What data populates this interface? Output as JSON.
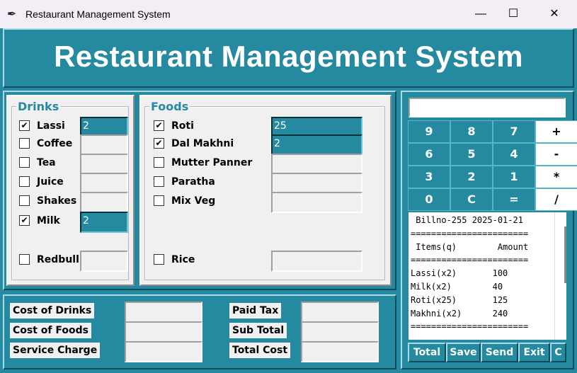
{
  "window": {
    "title": "Restaurant Management System",
    "minimize_glyph": "—",
    "maximize_glyph": "☐",
    "close_glyph": "✕"
  },
  "header": {
    "title": "Restaurant Management System"
  },
  "drinks": {
    "legend": "Drinks",
    "items": [
      {
        "label": "Lassi",
        "checked": true,
        "value": "2"
      },
      {
        "label": "Coffee",
        "checked": false,
        "value": ""
      },
      {
        "label": "Tea",
        "checked": false,
        "value": ""
      },
      {
        "label": "Juice",
        "checked": false,
        "value": ""
      },
      {
        "label": "Shakes",
        "checked": false,
        "value": ""
      },
      {
        "label": "Milk",
        "checked": true,
        "value": "2"
      },
      {
        "label": "Redbull",
        "checked": false,
        "value": ""
      }
    ]
  },
  "foods": {
    "legend": "Foods",
    "items": [
      {
        "label": "Roti",
        "checked": true,
        "value": "25"
      },
      {
        "label": "Dal Makhni",
        "checked": true,
        "value": "2"
      },
      {
        "label": "Mutter Panner",
        "checked": false,
        "value": ""
      },
      {
        "label": "Paratha",
        "checked": false,
        "value": ""
      },
      {
        "label": "Mix Veg",
        "checked": false,
        "value": ""
      },
      {
        "label": "Rice",
        "checked": false,
        "value": ""
      }
    ]
  },
  "costs": {
    "cost_of_drinks": "Cost of Drinks",
    "cost_of_foods": "Cost of Foods",
    "service_charge": "Service Charge",
    "paid_tax": "Paid Tax",
    "sub_total": "Sub Total",
    "total_cost": "Total Cost"
  },
  "calculator": {
    "display": "",
    "keys": [
      "9",
      "8",
      "7",
      "+",
      "6",
      "5",
      "4",
      "-",
      "3",
      "2",
      "1",
      "*",
      "0",
      "C",
      "=",
      "/"
    ]
  },
  "receipt": {
    "text": " Billno-255 2025-01-21\n=======================\n Items(q)        Amount\n=======================\nLassi(x2)       100\nMilk(x2)        40\nRoti(x25)       125\nMakhni(x2)      240\n======================="
  },
  "actions": {
    "total": "Total",
    "save": "Save",
    "send": "Send",
    "exit": "Exit",
    "clear": "C"
  },
  "colors": {
    "teal": "#25899f",
    "panel": "#f0f0f0",
    "accent_text": "#25899f"
  }
}
